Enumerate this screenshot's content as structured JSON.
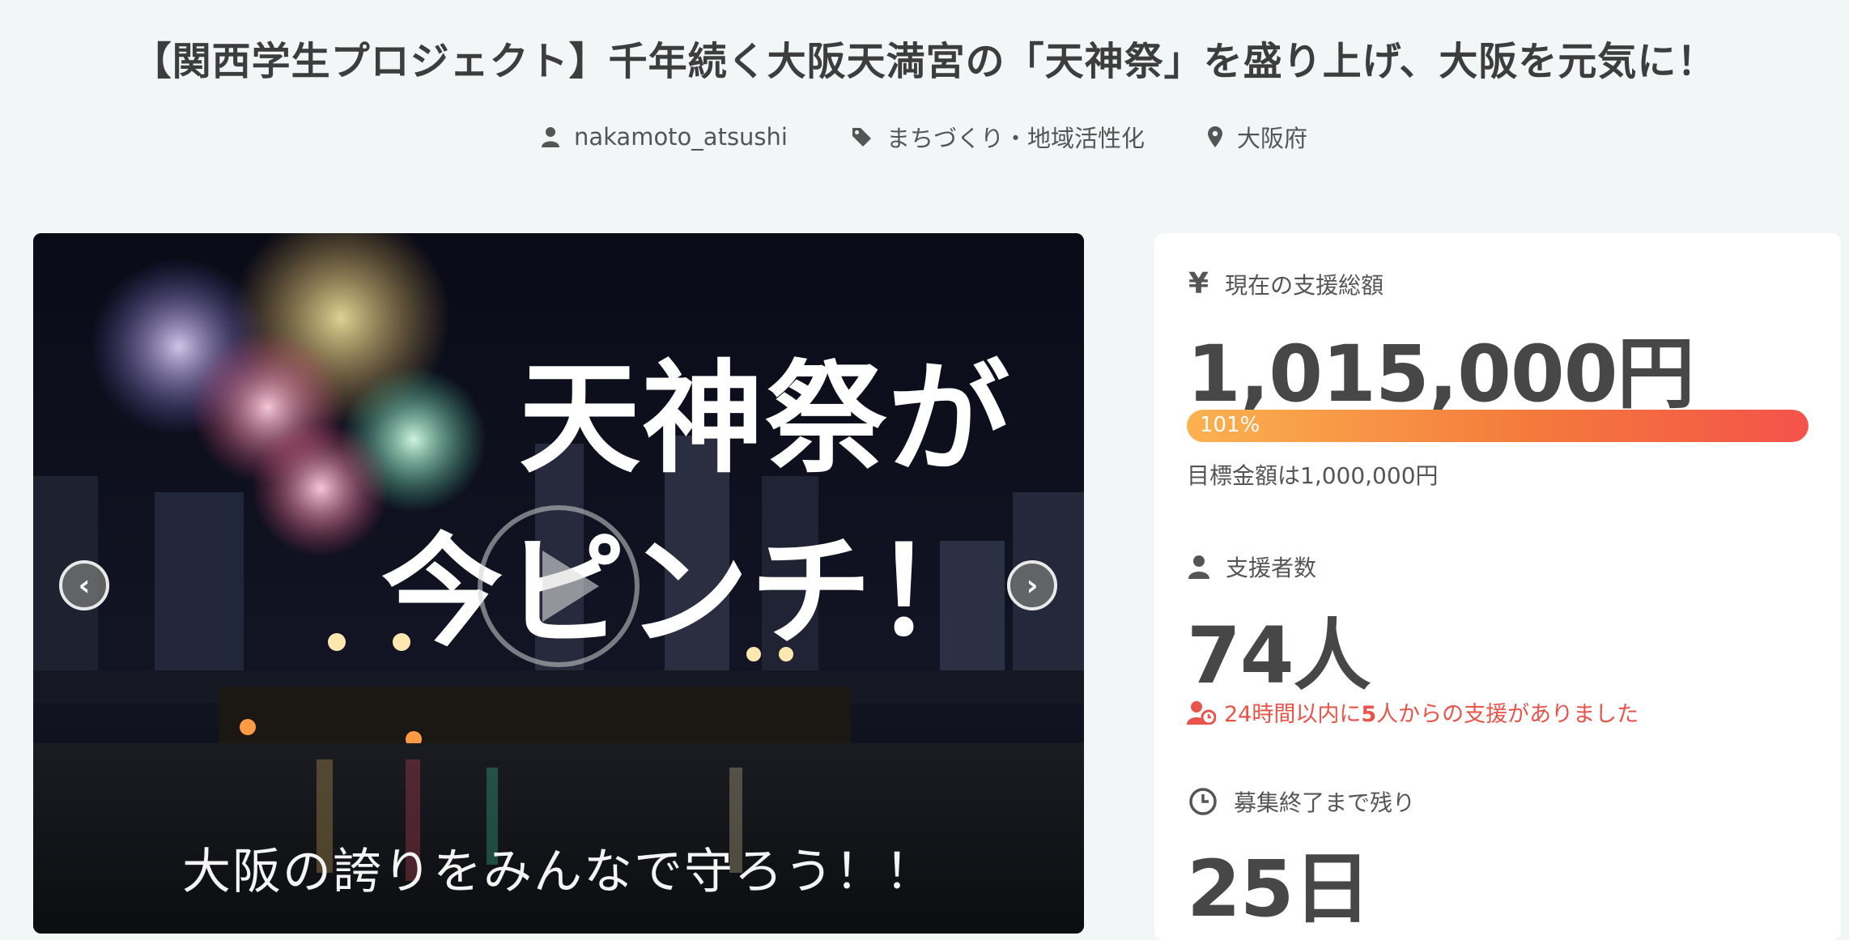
{
  "project": {
    "title": "【関西学生プロジェクト】千年続く大阪天満宮の「天神祭」を盛り上げ、大阪を元気に！",
    "author": "nakamoto_atsushi",
    "category": "まちづくり・地域活性化",
    "location": "大阪府"
  },
  "slide": {
    "line1": "天神祭が",
    "line2": "今ピンチ！",
    "subtitle": "大阪の誇りをみんなで守ろう！！"
  },
  "stats": {
    "total_label": "現在の支援総額",
    "total_amount": "1,015,000円",
    "progress_text": "101%",
    "progress_percent": 101,
    "goal_text": "目標金額は1,000,000円",
    "supporters_label": "支援者数",
    "supporters_count": "74人",
    "recent_prefix": "24時間以内に",
    "recent_count": "5",
    "recent_suffix": "人からの支援がありました",
    "remaining_label": "募集終了まで残り",
    "remaining_days": "25日"
  },
  "colors": {
    "accent_red": "#e8534a",
    "progress_start": "#fbb24f",
    "progress_end": "#f4524a"
  }
}
